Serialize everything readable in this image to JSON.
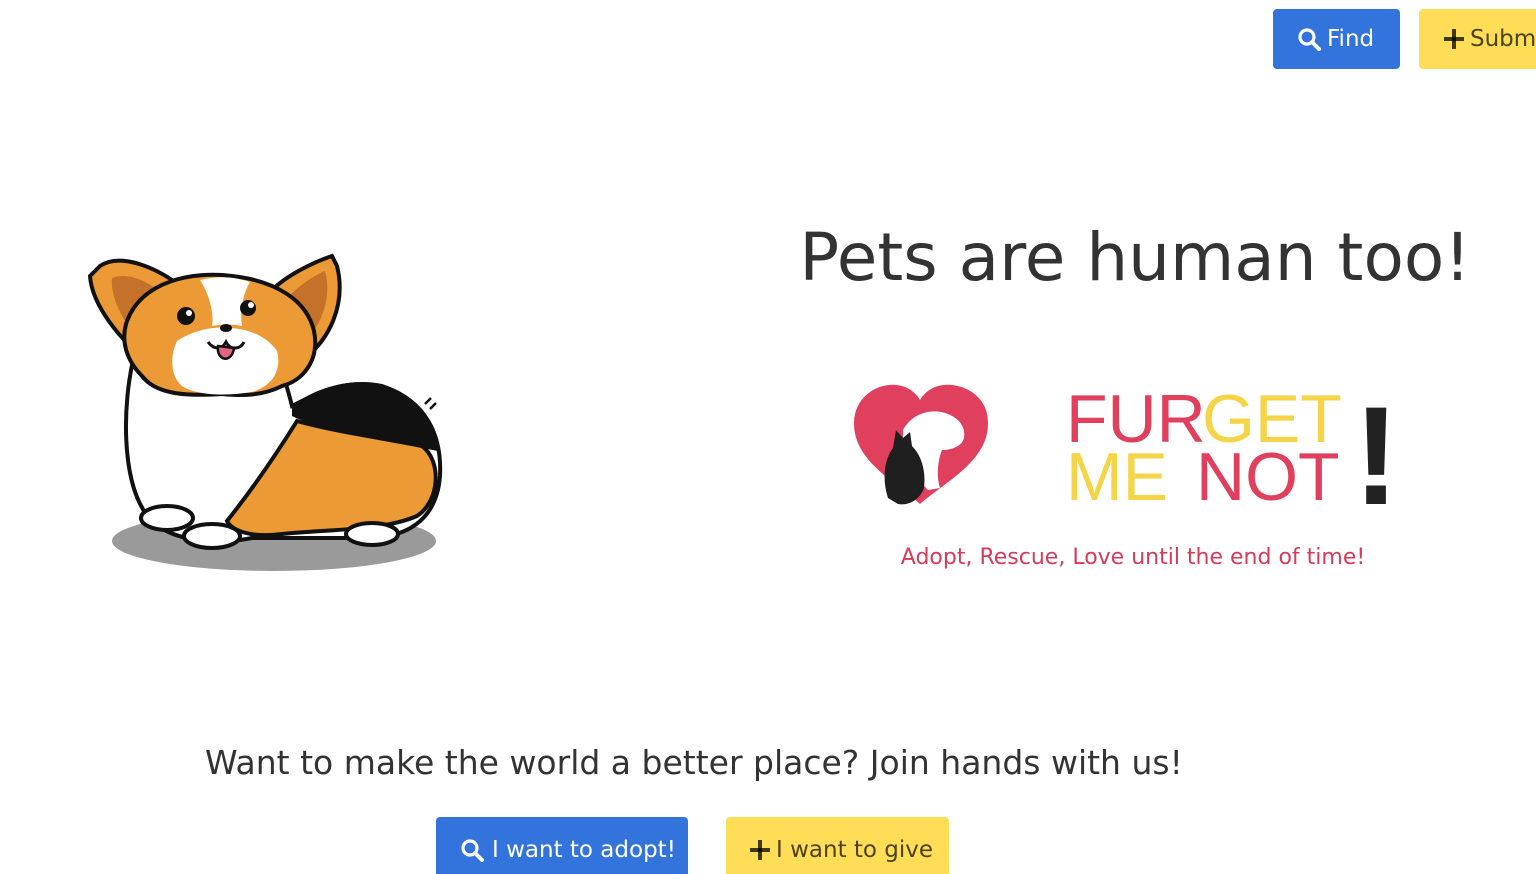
{
  "navbar": {
    "find_label": "Find",
    "submit_label": "Submit"
  },
  "hero": {
    "title": "Pets are human too!",
    "brand_line1_part1": "FUR",
    "brand_line1_part2": "GET",
    "brand_line2_part1": "ME ",
    "brand_line2_part2": "NOT",
    "brand_exclaim": "!",
    "tagline": "Adopt, Rescue, Love until the end of time!"
  },
  "cta": {
    "heading": "Want to make the world a better place? Join hands with us!",
    "adopt_label": "I want to adopt!",
    "give_label": "I want to give"
  },
  "colors": {
    "primary_blue": "#3273dc",
    "warning_yellow": "#ffdd57",
    "brand_pink": "#d83a5a",
    "brand_yellow": "#f5d547",
    "corgi_orange": "#ec9a35"
  },
  "icons": {
    "find": "search-icon",
    "submit": "plus-icon",
    "adopt": "search-icon",
    "give": "plus-icon"
  }
}
